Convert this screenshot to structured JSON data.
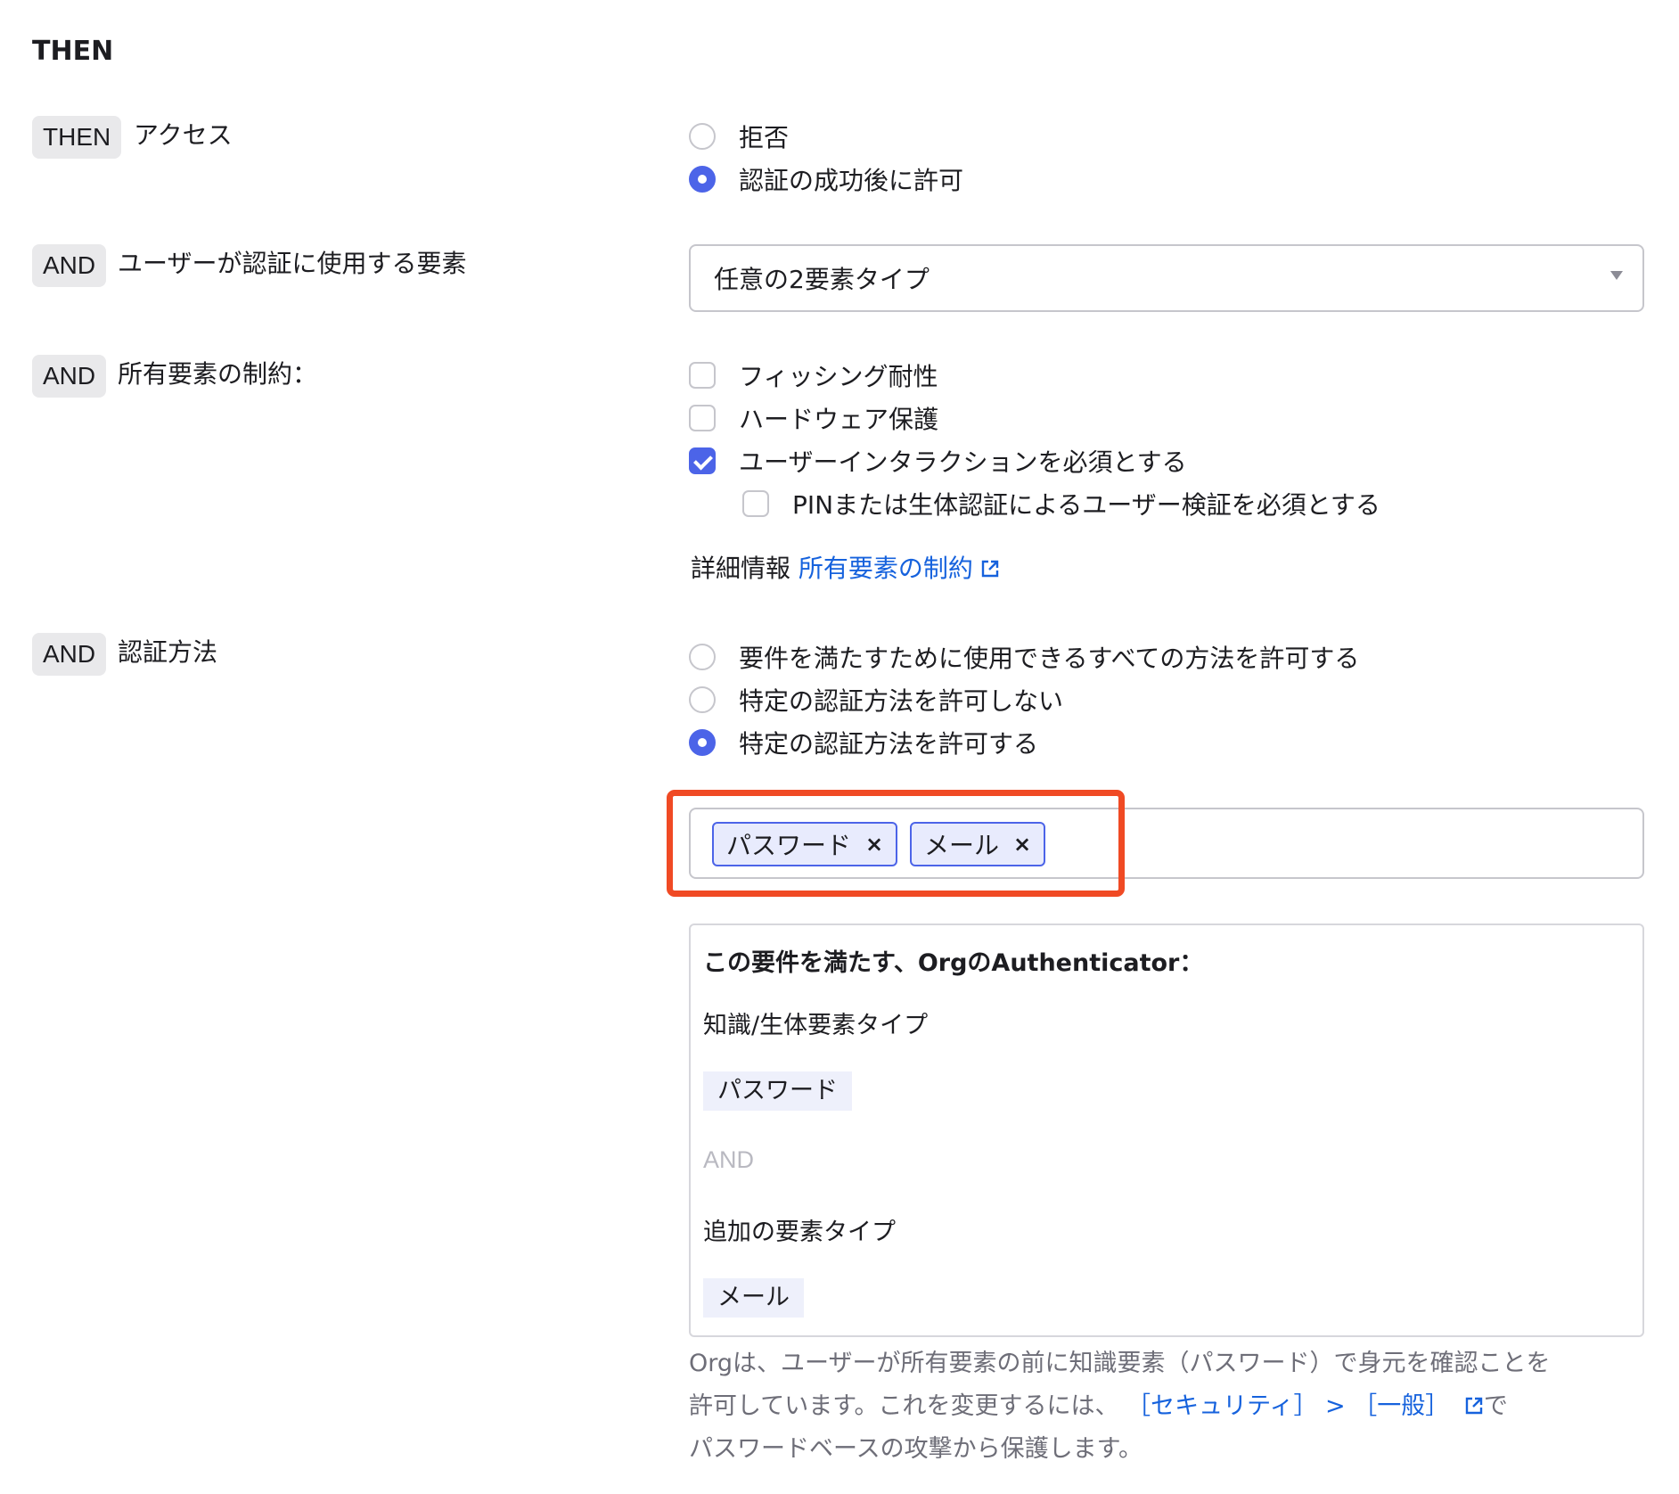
{
  "section_title": "THEN",
  "rows": {
    "access": {
      "tag": "THEN",
      "label": "アクセス",
      "options": [
        {
          "label": "拒否",
          "selected": false
        },
        {
          "label": "認証の成功後に許可",
          "selected": true
        }
      ]
    },
    "factors": {
      "tag": "AND",
      "label": "ユーザーが認証に使用する要素",
      "select_value": "任意の2要素タイプ"
    },
    "constraints": {
      "tag": "AND",
      "label": "所有要素の制約：",
      "options": [
        {
          "label": "フィッシング耐性",
          "checked": false
        },
        {
          "label": "ハードウェア保護",
          "checked": false
        },
        {
          "label": "ユーザーインタラクションを必須とする",
          "checked": true
        },
        {
          "label": "PINまたは生体認証によるユーザー検証を必須とする",
          "checked": false
        }
      ],
      "more_info_label": "詳細情報",
      "more_info_link": "所有要素の制約"
    },
    "methods": {
      "tag": "AND",
      "label": "認証方法",
      "options": [
        {
          "label": "要件を満たすために使用できるすべての方法を許可する",
          "selected": false
        },
        {
          "label": "特定の認証方法を許可しない",
          "selected": false
        },
        {
          "label": "特定の認証方法を許可する",
          "selected": true
        }
      ],
      "chips": [
        "パスワード",
        "メール"
      ],
      "chip_remove": "×"
    }
  },
  "info_box": {
    "title": "この要件を満たす、OrgのAuthenticator：",
    "group1_label": "知識/生体要素タイプ",
    "group1_item": "パスワード",
    "and_label": "AND",
    "group2_label": "追加の要素タイプ",
    "group2_item": "メール"
  },
  "footnote": {
    "line1": "Orgは、ユーザーが所有要素の前に知識要素（パスワード）で身元を確認ことを",
    "line2_prefix": "許可しています。これを変更するには、",
    "line2_link": "［セキュリティ］ > ［一般］",
    "line2_suffix": "で",
    "line3": "パスワードベースの攻撃から保護します。"
  },
  "colors": {
    "accent": "#4c64e8",
    "link": "#1662dd",
    "highlight": "#f04a24",
    "tag_bg": "#e9e9eb"
  }
}
